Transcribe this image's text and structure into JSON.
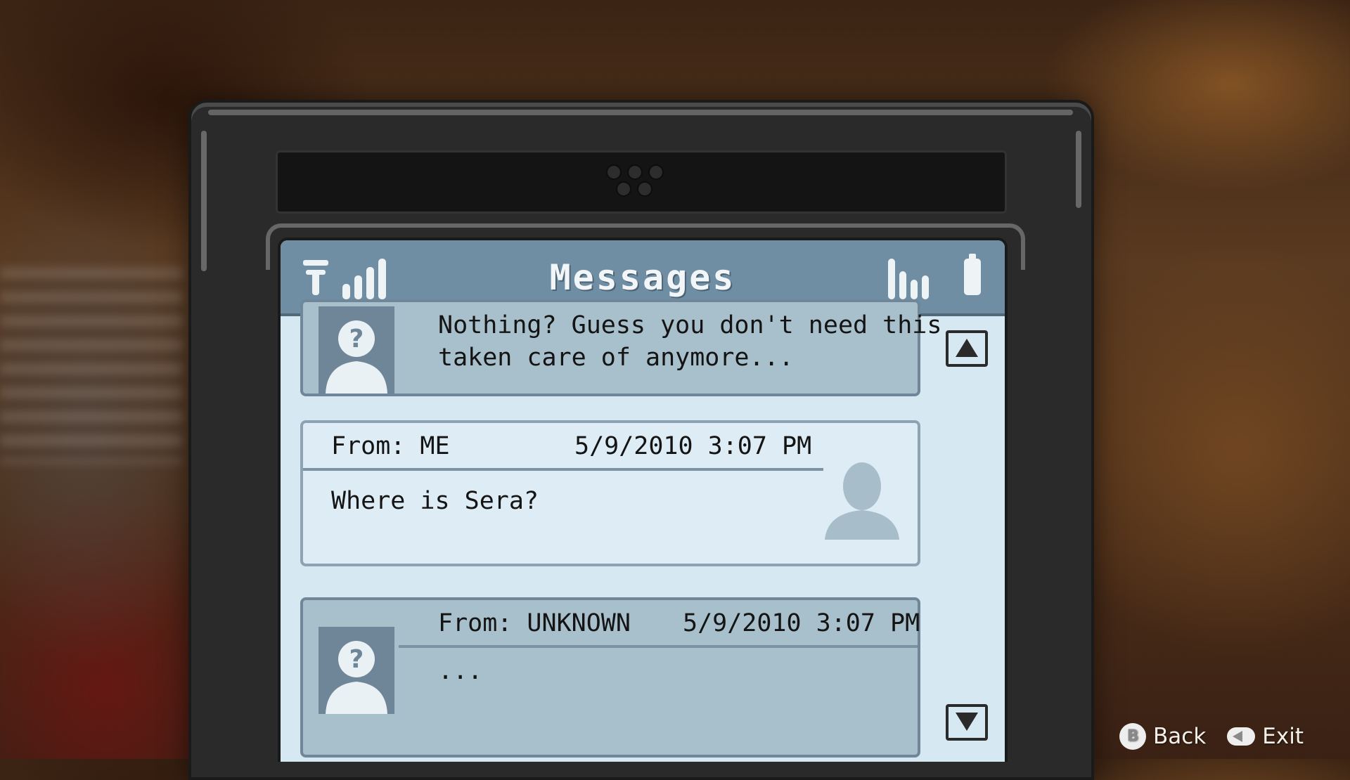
{
  "screen": {
    "title": "Messages"
  },
  "messages": [
    {
      "sender_type": "unknown",
      "from": "",
      "date": "",
      "body": "Nothing? Guess you don't need this\ntaken care of anymore..."
    },
    {
      "sender_type": "me",
      "from": "From: ME",
      "date": "5/9/2010 3:07 PM",
      "body": "Where is Sera?"
    },
    {
      "sender_type": "unknown",
      "from": "From: UNKNOWN",
      "date": "5/9/2010 3:07 PM",
      "body": "..."
    }
  ],
  "hints": {
    "back_glyph": "B",
    "back_label": "Back",
    "exit_label": "Exit"
  },
  "icons": {
    "carrier": "carrier-icon",
    "signal": "signal-bars-icon",
    "volume": "volume-bars-icon",
    "battery": "battery-icon",
    "scroll_up": "triangle-up-icon",
    "scroll_down": "triangle-down-icon",
    "unknown_avatar": "unknown-person-avatar",
    "me_avatar": "person-silhouette-avatar"
  },
  "colors": {
    "header": "#6f8ea4",
    "screen": "#d6e8f1",
    "unknown_bubble": "#a8bfcc",
    "me_bubble": "#deedf5"
  }
}
